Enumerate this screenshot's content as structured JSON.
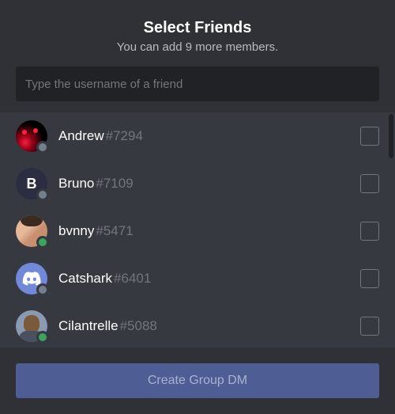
{
  "header": {
    "title": "Select Friends",
    "subtitle": "You can add 9 more members."
  },
  "search": {
    "placeholder": "Type the username of a friend",
    "value": ""
  },
  "friends": [
    {
      "name": "Andrew",
      "tag": "#7294",
      "status": "offline",
      "avatar": "andrew"
    },
    {
      "name": "Bruno",
      "tag": "#7109",
      "status": "offline",
      "avatar": "bruno",
      "letter": "B"
    },
    {
      "name": "bvnny",
      "tag": "#5471",
      "status": "online",
      "avatar": "bvnny"
    },
    {
      "name": "Catshark",
      "tag": "#6401",
      "status": "offline",
      "avatar": "catshark"
    },
    {
      "name": "Cilantrelle",
      "tag": "#5088",
      "status": "online",
      "avatar": "cilantrelle"
    }
  ],
  "footer": {
    "create_label": "Create Group DM"
  }
}
